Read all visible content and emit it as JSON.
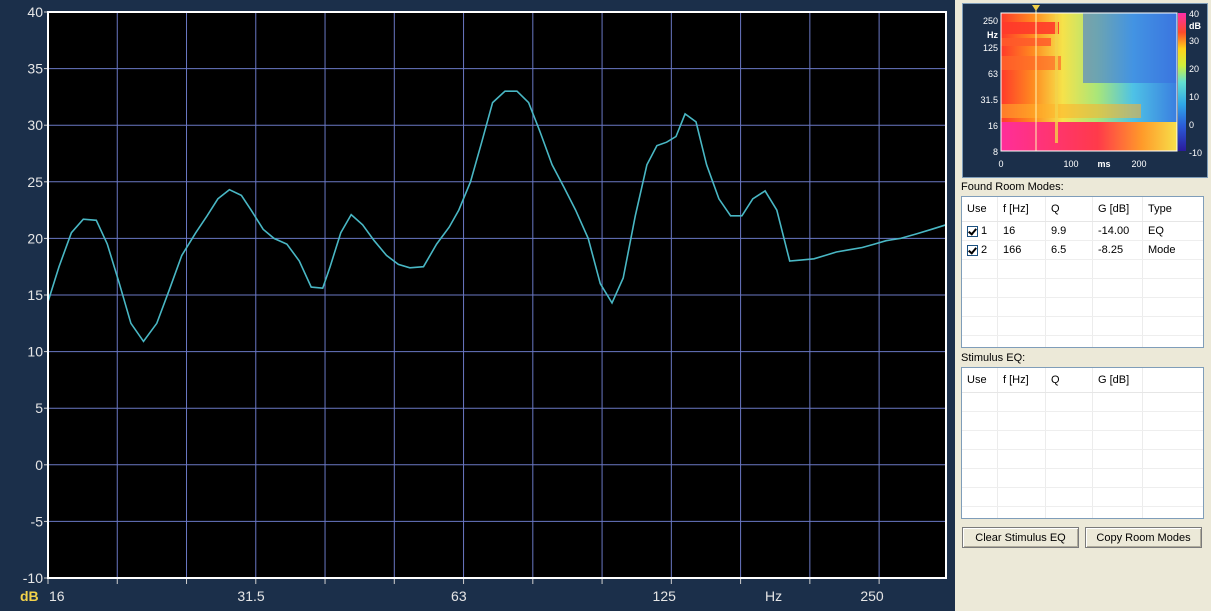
{
  "graph": {
    "unit_label": "dB",
    "x_unit_label": "Hz",
    "y_ticks": [
      "40",
      "35",
      "30",
      "25",
      "20",
      "15",
      "10",
      "5",
      "0",
      "-5",
      "-10"
    ],
    "x_ticks": [
      "16",
      "31.5",
      "63",
      "125",
      "250"
    ],
    "line_color": "#49b7c4",
    "grid_color": "#6a78c4",
    "background_color": "#000000"
  },
  "chart_data": {
    "type": "line",
    "xscale": "log",
    "xlim": [
      16,
      320
    ],
    "ylim": [
      -10,
      40
    ],
    "series": [
      {
        "x": [
          16,
          16.6,
          17.3,
          18,
          18.8,
          19.5,
          20.3,
          21.1,
          22,
          23,
          24,
          25,
          26.2,
          27.2,
          28.2,
          29.3,
          30.5,
          31.5,
          32.8,
          34,
          35.5,
          37,
          38.5,
          40,
          41,
          42.5,
          44,
          45.7,
          47.5,
          49.5,
          51.5,
          53.5,
          56,
          58.5,
          61,
          63,
          65.5,
          68,
          70.5,
          73.5,
          76.5,
          79.5,
          82.5,
          86,
          89.5,
          93,
          97,
          101,
          105,
          109,
          113.5,
          118,
          122,
          126,
          130,
          134,
          139,
          144,
          150,
          156,
          162,
          168,
          175,
          182,
          190,
          198,
          206,
          214,
          222,
          232,
          242,
          252,
          262,
          275,
          290,
          305,
          320
        ],
        "y": [
          14.4,
          17.5,
          20.5,
          21.7,
          21.6,
          19.5,
          16,
          12.5,
          10.9,
          12.5,
          15.5,
          18.5,
          20.5,
          22,
          23.5,
          24.3,
          23.8,
          22.5,
          20.8,
          20,
          19.5,
          18,
          15.7,
          15.6,
          17.5,
          20.5,
          22.1,
          21.2,
          19.8,
          18.5,
          17.7,
          17.4,
          17.5,
          19.5,
          21,
          22.5,
          25,
          28.5,
          32,
          33,
          33,
          32,
          29.5,
          26.5,
          24.5,
          22.5,
          20,
          16,
          14.3,
          16.5,
          22,
          26.5,
          28.2,
          28.5,
          29,
          31,
          30.3,
          26.5,
          23.5,
          22,
          22,
          23.5,
          24.2,
          22.5,
          18,
          18.1,
          18.2,
          18.5,
          18.8,
          19,
          19.2,
          19.5,
          19.8,
          20,
          20.4,
          20.8,
          21.2
        ]
      }
    ]
  },
  "spectrogram": {
    "y_labels": [
      "250",
      "Hz",
      "125",
      "63",
      "31.5",
      "16",
      "8"
    ],
    "x_labels": [
      "0",
      "100",
      "ms",
      "200"
    ],
    "colorbar_labels": [
      "40",
      "dB",
      "30",
      "20",
      "10",
      "0",
      "-10"
    ]
  },
  "room_modes": {
    "title": "Found Room Modes:",
    "headers": [
      "Use",
      "f [Hz]",
      "Q",
      "G [dB]",
      "Type"
    ],
    "rows": [
      {
        "use": "1",
        "f": "16",
        "q": "9.9",
        "g": "-14.00",
        "type": "EQ"
      },
      {
        "use": "2",
        "f": "166",
        "q": "6.5",
        "g": "-8.25",
        "type": "Mode"
      }
    ]
  },
  "stimulus_eq": {
    "title": "Stimulus EQ:",
    "headers": [
      "Use",
      "f [Hz]",
      "Q",
      "G [dB]"
    ]
  },
  "buttons": {
    "clear_label": "Clear Stimulus EQ",
    "copy_label": "Copy Room Modes"
  }
}
